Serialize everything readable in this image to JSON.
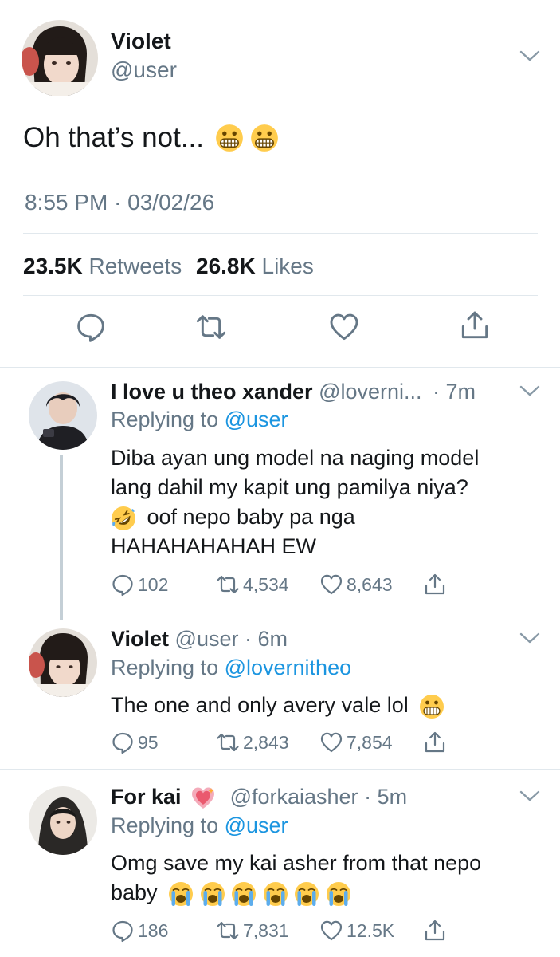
{
  "main_tweet": {
    "name": "Violet",
    "handle": "@user",
    "text": "Oh that’s not...",
    "emojis": [
      "grimacing-face",
      "grimacing-face"
    ],
    "time": "8:55 PM · 03/02/26",
    "retweets_count": "23.5K",
    "retweets_label": "Retweets",
    "likes_count": "26.8K",
    "likes_label": "Likes"
  },
  "replies": [
    {
      "name": "I love u theo xander",
      "handle": "@loverni...",
      "time": "· 7m",
      "replying_prefix": "Replying to",
      "replying_to": "@user",
      "line1": "Diba ayan ung model na naging model",
      "line2": "lang dahil my kapit ung pamilya niya?",
      "line3": "oof nepo baby pa nga",
      "line4": "HAHAHAHAHAH EW",
      "emoji": "rolling-on-floor-laughing",
      "replies": "102",
      "retweets": "4,534",
      "likes": "8,643"
    },
    {
      "name": "Violet",
      "handle": "@user",
      "time": "· 6m",
      "replying_prefix": "Replying to",
      "replying_to": "@lovernitheo",
      "line1": "The one and only avery vale lol",
      "emoji": "grimacing-face",
      "replies": "95",
      "retweets": "2,843",
      "likes": "7,854"
    },
    {
      "name": "For kai",
      "name_emoji": "sparkling-heart",
      "handle": "@forkaiasher",
      "time": "· 5m",
      "replying_prefix": "Replying to",
      "replying_to": "@user",
      "line1": "Omg save my kai asher from that nepo",
      "line2": "baby",
      "emoji": "loudly-crying-face",
      "replies": "186",
      "retweets": "7,831",
      "likes": "12.5K"
    }
  ],
  "colors": {
    "text": "#14171a",
    "secondary": "#657786",
    "link": "#1b95e0",
    "divider": "#e1e8ed",
    "thread_line": "#c4cfd6"
  }
}
